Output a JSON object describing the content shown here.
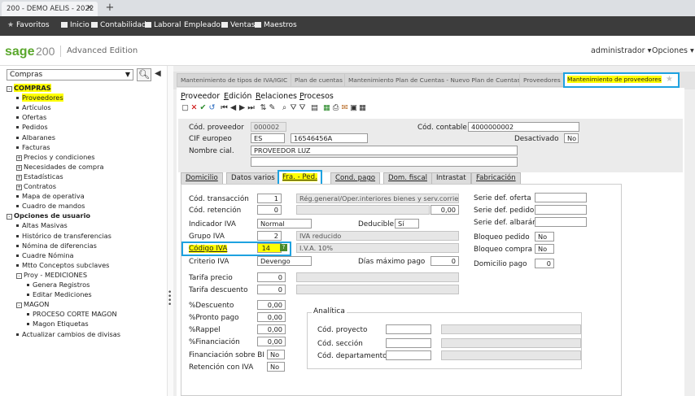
{
  "browser": {
    "tab_title": "200 - DEMO AELIS - 2022",
    "close": "✕",
    "new_tab": "+"
  },
  "favbar": {
    "favorites": "Favoritos",
    "items": [
      "Inicio",
      "Contabilidad",
      "Laboral",
      "Empleado",
      "Ventas",
      "Maestros"
    ]
  },
  "header": {
    "brand": "sage",
    "brand_num": "200",
    "edition": "Advanced Edition",
    "user": "administrador ▾",
    "options": "Opciones ▾"
  },
  "sidebar": {
    "module": "Compras",
    "tree": [
      {
        "label": "COMPRAS",
        "level": 0,
        "expand": "-",
        "hl": true
      },
      {
        "label": "Proveedores",
        "level": 1,
        "hl": true
      },
      {
        "label": "Artículos",
        "level": 1
      },
      {
        "label": "Ofertas",
        "level": 1
      },
      {
        "label": "Pedidos",
        "level": 1
      },
      {
        "label": "Albaranes",
        "level": 1
      },
      {
        "label": "Facturas",
        "level": 1
      },
      {
        "label": "Precios y condiciones",
        "level": 1,
        "expand": "+"
      },
      {
        "label": "Necesidades de compra",
        "level": 1,
        "expand": "+"
      },
      {
        "label": "Estadísticas",
        "level": 1,
        "expand": "+"
      },
      {
        "label": "Contratos",
        "level": 1,
        "expand": "+"
      },
      {
        "label": "Mapa de operativa",
        "level": 1
      },
      {
        "label": "Cuadro de mandos",
        "level": 1
      },
      {
        "label": "Opciones de usuario",
        "level": 0,
        "expand": "-"
      },
      {
        "label": "Altas Masivas",
        "level": 1
      },
      {
        "label": "Histórico de transferencias",
        "level": 1
      },
      {
        "label": "Nómina de diferencias",
        "level": 1
      },
      {
        "label": "Cuadre Nómina",
        "level": 1
      },
      {
        "label": "Mtto Conceptos subclaves",
        "level": 1
      },
      {
        "label": "Proy - MEDICIONES",
        "level": 1,
        "expand": "-"
      },
      {
        "label": "Genera Registros",
        "level": 2
      },
      {
        "label": "Editar Mediciones",
        "level": 2
      },
      {
        "label": "MAGON",
        "level": 1,
        "expand": "-"
      },
      {
        "label": "PROCESO CORTE MAGON",
        "level": 2
      },
      {
        "label": "Magon Etiquetas",
        "level": 2
      },
      {
        "label": "Actualizar cambios de divisas",
        "level": 1
      }
    ]
  },
  "nav_tabs": [
    "Mantenimiento de tipos de IVA/IGIC",
    "Plan de cuentas",
    "Mantenimiento Plan de Cuentas - Nuevo Plan de Cuentas",
    "Proveedores"
  ],
  "nav_tab_active": "Mantenimiento de proveedores",
  "menu": [
    {
      "label": "Proveedor",
      "u": "P"
    },
    {
      "label": "Edición",
      "u": "E"
    },
    {
      "label": "Relaciones",
      "u": "R"
    },
    {
      "label": "Procesos",
      "u": "P"
    }
  ],
  "form": {
    "cod_proveedor_label": "Cód. proveedor",
    "cod_proveedor": "000002",
    "cod_contable_label": "Cód. contable",
    "cod_contable": "4000000002",
    "cif_label": "CIF europeo",
    "cif_pais": "ES",
    "cif": "16546456A",
    "desactivado_label": "Desactivado",
    "desactivado": "No",
    "nombre_label": "Nombre cial.",
    "nombre": "PROVEEDOR LUZ"
  },
  "detail_tabs": [
    "Domicilio",
    "Datos varios",
    "Cond. pago",
    "Dom. fiscal",
    "Intrastat",
    "Fabricación"
  ],
  "detail_tab_active": "Fra. - Ped.",
  "fields": {
    "cod_transaccion_label": "Cód. transacción",
    "cod_transaccion": "1",
    "cod_transaccion_desc": "Rég.general/Oper.interiores bienes y serv.corrien.",
    "cod_retencion_label": "Cód. retención",
    "cod_retencion": "0",
    "retencion_pct": "0,00",
    "indicador_iva_label": "Indicador IVA",
    "indicador_iva": "Normal",
    "deducible_label": "Deducible",
    "deducible": "Sí",
    "grupo_iva_label": "Grupo IVA",
    "grupo_iva": "2",
    "grupo_iva_desc": "IVA reducido",
    "codigo_iva_label": "Código IVA",
    "codigo_iva": "14",
    "codigo_iva_desc": "I.V.A. 10%",
    "criterio_iva_label": "Criterio IVA",
    "criterio_iva": "Devengo",
    "dias_max_label": "Días máximo pago",
    "dias_max": "0",
    "tarifa_precio_label": "Tarifa precio",
    "tarifa_precio": "0",
    "tarifa_descuento_label": "Tarifa descuento",
    "tarifa_descuento": "0",
    "descuento_label": "%Descuento",
    "descuento": "0,00",
    "pronto_pago_label": "%Pronto pago",
    "pronto_pago": "0,00",
    "rappel_label": "%Rappel",
    "rappel": "0,00",
    "financiacion_label": "%Financiación",
    "financiacion": "0,00",
    "fin_sobre_bi_label": "Financiación sobre BI",
    "fin_sobre_bi": "No",
    "retencion_iva_label": "Retención con IVA",
    "retencion_iva": "No",
    "serie_oferta_label": "Serie def. oferta",
    "serie_pedido_label": "Serie def. pedido",
    "serie_albaran_label": "Serie def. albarán",
    "bloqueo_pedido_label": "Bloqueo pedido",
    "bloqueo_pedido": "No",
    "bloqueo_compra_label": "Bloqueo compra",
    "bloqueo_compra": "No",
    "domicilio_pago_label": "Domicilio pago",
    "domicilio_pago": "0",
    "analitica_label": "Analítica",
    "proyecto_label": "Cód. proyecto",
    "seccion_label": "Cód. sección",
    "departamento_label": "Cód. departamento"
  },
  "colors": {
    "highlight": "#ffff00",
    "callout": "#1ea2e0",
    "sage_green": "#5aa72c"
  }
}
